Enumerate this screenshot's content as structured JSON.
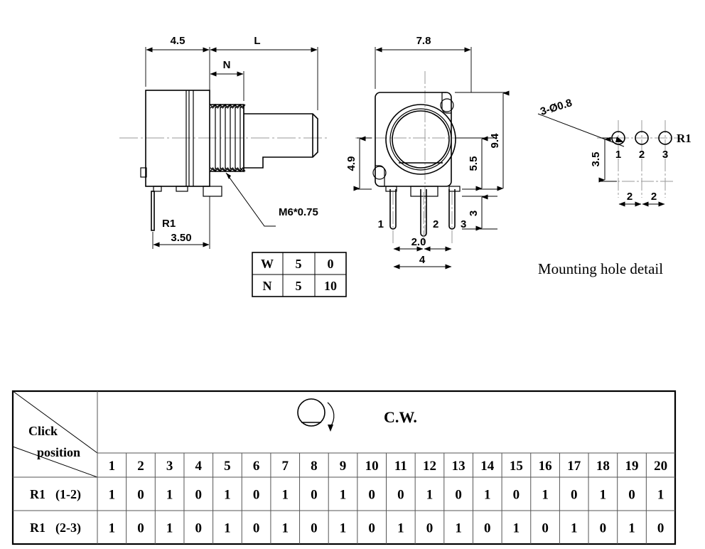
{
  "drawing": {
    "title": "Potentiometer outline dimension drawing",
    "side_view": {
      "name": "side-view",
      "dims": {
        "body_width": "4.5",
        "shaft_total": "L",
        "thread_len": "N",
        "thread_spec": "M6*0.75",
        "terminal_ref": "R1",
        "terminal_len": "3.50"
      }
    },
    "front_view": {
      "name": "front-view",
      "dims": {
        "width": "7.8",
        "height_total": "9.4",
        "height_body": "5.5",
        "height_left": "4.9",
        "pin_len": "3",
        "pin_pitch_half": "2.0",
        "pin_span": "4"
      },
      "pins": [
        "1",
        "2",
        "3"
      ]
    },
    "mounting_detail": {
      "name": "mounting-hole-detail",
      "caption": "Mounting hole detail",
      "hole_note": "3-Ø0.8",
      "ref": "R1",
      "dim_vertical": "3.5",
      "dim_pitch_1": "2",
      "dim_pitch_2": "2",
      "hole_labels": [
        "1",
        "2",
        "3"
      ]
    },
    "wn_table": {
      "name": "wn-table",
      "rows": [
        {
          "label": "W",
          "values": [
            "5",
            "0"
          ]
        },
        {
          "label": "N",
          "values": [
            "5",
            "10"
          ]
        }
      ]
    }
  },
  "click_table": {
    "name": "click-position-table",
    "corner_label_line1": "Click",
    "corner_label_line2": "position",
    "rotation_label": "C.W.",
    "rotation_icon": "shaft-d-cut-icon",
    "arrow_icon": "curved-arrow-icon",
    "positions": [
      "1",
      "2",
      "3",
      "4",
      "5",
      "6",
      "7",
      "8",
      "9",
      "10",
      "11",
      "12",
      "13",
      "14",
      "15",
      "16",
      "17",
      "18",
      "19",
      "20"
    ],
    "rows": [
      {
        "label": "R1",
        "pins": "(1-2)",
        "values": [
          "1",
          "0",
          "1",
          "0",
          "1",
          "0",
          "1",
          "0",
          "1",
          "0",
          "0",
          "1",
          "0",
          "1",
          "0",
          "1",
          "0",
          "1",
          "0",
          "1"
        ]
      },
      {
        "label": "R1",
        "pins": "(2-3)",
        "values": [
          "1",
          "0",
          "1",
          "0",
          "1",
          "0",
          "1",
          "0",
          "1",
          "0",
          "1",
          "0",
          "1",
          "0",
          "1",
          "0",
          "1",
          "0",
          "1",
          "0"
        ]
      }
    ]
  },
  "colors": {
    "line": "#000000",
    "centerline": "#9a9a9a",
    "table_grid": "#555555",
    "background": "#ffffff"
  }
}
